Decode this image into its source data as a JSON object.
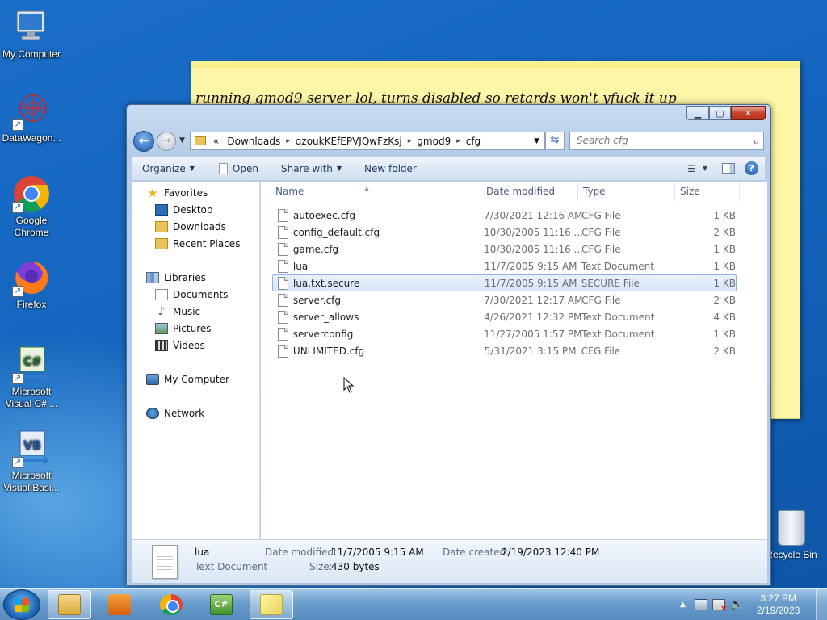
{
  "desktop": {
    "icons": [
      {
        "label": "My Computer"
      },
      {
        "label": "DataWagon..."
      },
      {
        "label": "Google Chrome"
      },
      {
        "label": "Firefox"
      },
      {
        "label": "Microsoft Visual C# ..."
      },
      {
        "label": "Microsoft Visual Basi..."
      }
    ],
    "recycle_bin": "Recycle Bin"
  },
  "sticky_note": {
    "text": "running gmod9 server lol, turns disabled so retards won't yfuck it up"
  },
  "explorer": {
    "window_buttons": {
      "minimize": "▁",
      "maximize": "▢",
      "close": "✕"
    },
    "address": {
      "overflow": "«",
      "crumbs": [
        "Downloads",
        "qzoukKEfEPVJQwFzKsj",
        "gmod9",
        "cfg"
      ],
      "separator": "▸"
    },
    "search": {
      "placeholder": "Search cfg"
    },
    "toolbar": {
      "organize": "Organize",
      "open": "Open",
      "share_with": "Share with",
      "new_folder": "New folder"
    },
    "nav": {
      "favorites": "Favorites",
      "desktop": "Desktop",
      "downloads": "Downloads",
      "recent_places": "Recent Places",
      "libraries": "Libraries",
      "documents": "Documents",
      "music": "Music",
      "pictures": "Pictures",
      "videos": "Videos",
      "my_computer": "My Computer",
      "network": "Network"
    },
    "columns": {
      "name": "Name",
      "date_modified": "Date modified",
      "type": "Type",
      "size": "Size"
    },
    "files": [
      {
        "name": "autoexec.cfg",
        "date": "7/30/2021 12:16 AM",
        "type": "CFG File",
        "size": "1 KB"
      },
      {
        "name": "config_default.cfg",
        "date": "10/30/2005 11:16 ...",
        "type": "CFG File",
        "size": "2 KB"
      },
      {
        "name": "game.cfg",
        "date": "10/30/2005 11:16 ...",
        "type": "CFG File",
        "size": "1 KB"
      },
      {
        "name": "lua",
        "date": "11/7/2005 9:15 AM",
        "type": "Text Document",
        "size": "1 KB"
      },
      {
        "name": "lua.txt.secure",
        "date": "11/7/2005 9:15 AM",
        "type": "SECURE File",
        "size": "1 KB"
      },
      {
        "name": "server.cfg",
        "date": "7/30/2021 12:17 AM",
        "type": "CFG File",
        "size": "2 KB"
      },
      {
        "name": "server_allows",
        "date": "4/26/2021 12:32 PM",
        "type": "Text Document",
        "size": "4 KB"
      },
      {
        "name": "serverconfig",
        "date": "11/27/2005 1:57 PM",
        "type": "Text Document",
        "size": "1 KB"
      },
      {
        "name": "UNLIMITED.cfg",
        "date": "5/31/2021 3:15 PM",
        "type": "CFG File",
        "size": "2 KB"
      }
    ],
    "selected_index": 4,
    "details": {
      "name": "lua",
      "type": "Text Document",
      "date_modified_label": "Date modified:",
      "date_modified": "11/7/2005 9:15 AM",
      "date_created_label": "Date created:",
      "date_created": "2/19/2023 12:40 PM",
      "size_label": "Size:",
      "size": "430 bytes"
    }
  },
  "taskbar": {
    "time": "3:27 PM",
    "date": "2/19/2023",
    "csharp_glyph": "C#"
  }
}
